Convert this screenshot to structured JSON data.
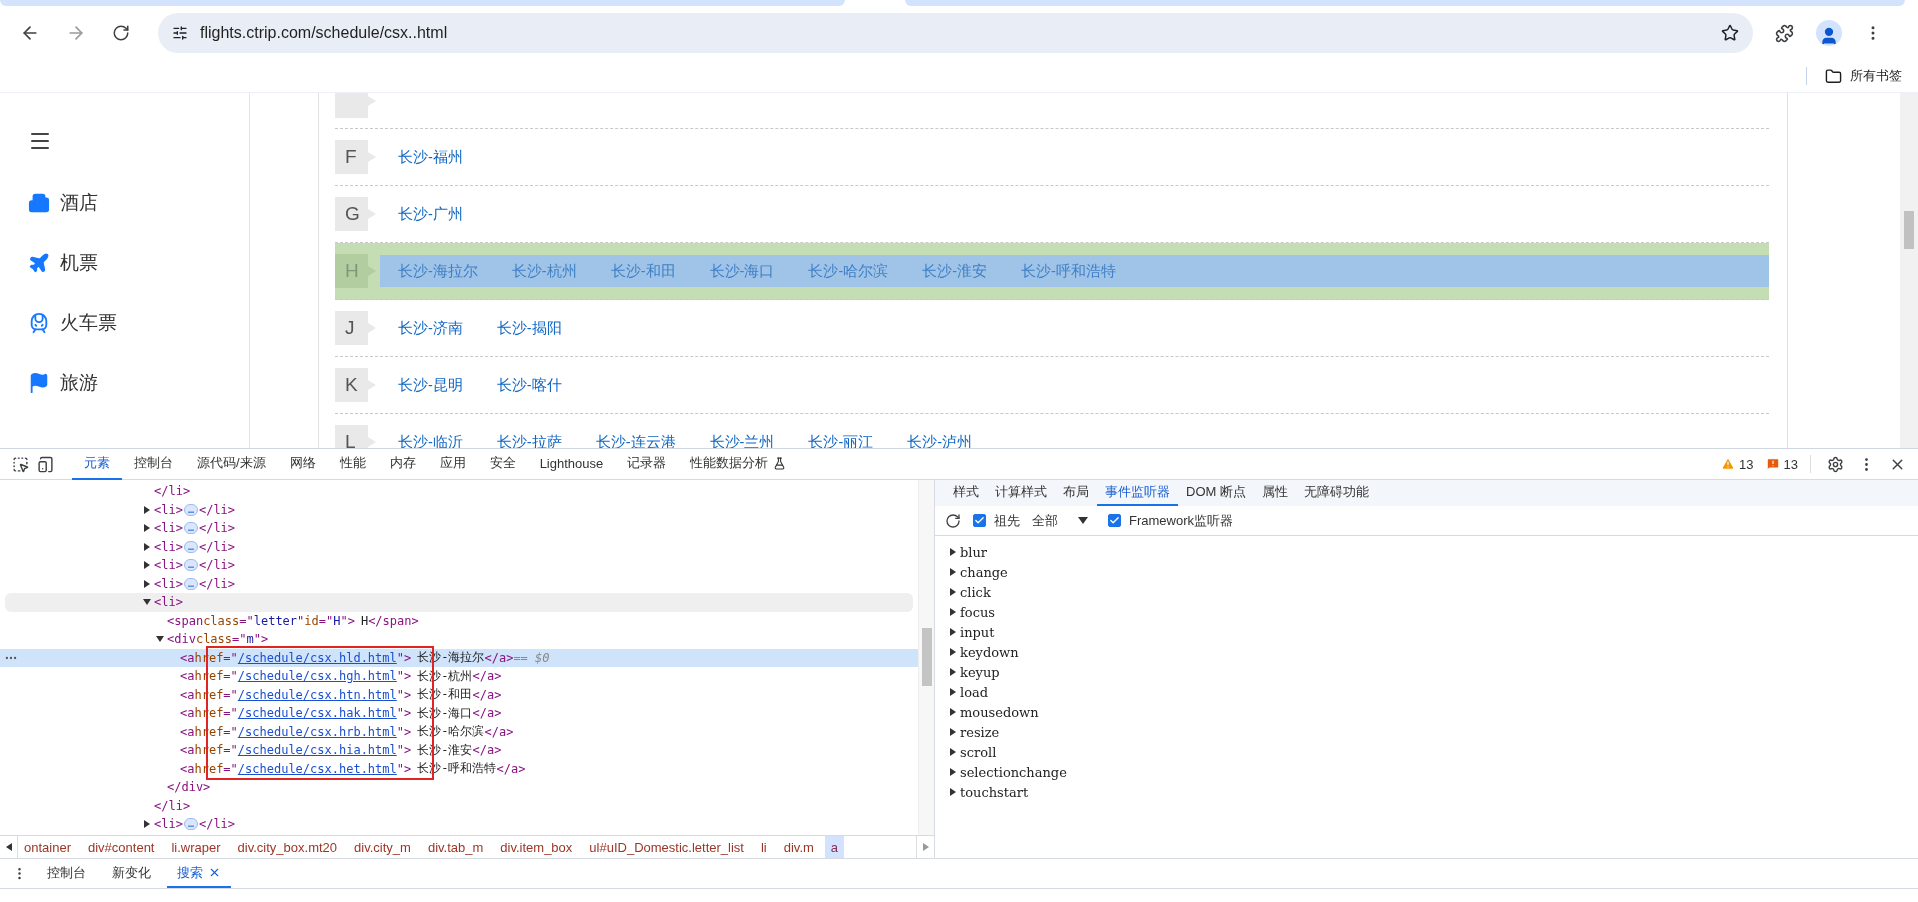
{
  "browser": {
    "url": "flights.ctrip.com/schedule/csx..html",
    "bookmarks_folder": "所有书签"
  },
  "page": {
    "sidebar": [
      {
        "kind": "hotel",
        "label": "酒店"
      },
      {
        "kind": "flight",
        "label": "机票"
      },
      {
        "kind": "train",
        "label": "火车票"
      },
      {
        "kind": "travel",
        "label": "旅游"
      }
    ],
    "letter_rows": [
      {
        "letter": "F",
        "highlighted": false,
        "links": [
          "长沙-福州"
        ]
      },
      {
        "letter": "G",
        "highlighted": false,
        "links": [
          "长沙-广州"
        ]
      },
      {
        "letter": "H",
        "highlighted": true,
        "links": [
          "长沙-海拉尔",
          "长沙-杭州",
          "长沙-和田",
          "长沙-海口",
          "长沙-哈尔滨",
          "长沙-淮安",
          "长沙-呼和浩特"
        ]
      },
      {
        "letter": "J",
        "highlighted": false,
        "links": [
          "长沙-济南",
          "长沙-揭阳"
        ]
      },
      {
        "letter": "K",
        "highlighted": false,
        "links": [
          "长沙-昆明",
          "长沙-喀什"
        ]
      },
      {
        "letter": "L",
        "highlighted": false,
        "links": [
          "长沙-临沂",
          "长沙-拉萨",
          "长沙-连云港",
          "长沙-兰州",
          "长沙-丽江",
          "长沙-泸州"
        ]
      }
    ]
  },
  "devtools": {
    "tabs": [
      {
        "label": "元素",
        "selected": true
      },
      {
        "label": "控制台",
        "selected": false
      },
      {
        "label": "源代码/来源",
        "selected": false
      },
      {
        "label": "网络",
        "selected": false
      },
      {
        "label": "性能",
        "selected": false
      },
      {
        "label": "内存",
        "selected": false
      },
      {
        "label": "应用",
        "selected": false
      },
      {
        "label": "安全",
        "selected": false
      },
      {
        "label": "Lighthouse",
        "selected": false
      },
      {
        "label": "记录器",
        "selected": false
      },
      {
        "label": "性能数据分析",
        "selected": false
      }
    ],
    "warnings": "13",
    "issues": "13",
    "dom_tree": [
      {
        "selected": false,
        "hovered": false,
        "tokens": [
          {
            "kind": "tag",
            "text": "</li>"
          }
        ]
      },
      {
        "selected": false,
        "hovered": false,
        "expanded": false,
        "tokens": [
          {
            "kind": "tag",
            "text": "<li>"
          },
          {
            "kind": "ellipsis",
            "text": "…"
          },
          {
            "kind": "tag",
            "text": "</li>"
          }
        ]
      },
      {
        "selected": false,
        "hovered": false,
        "expanded": false,
        "tokens": [
          {
            "kind": "tag",
            "text": "<li>"
          },
          {
            "kind": "ellipsis",
            "text": "…"
          },
          {
            "kind": "tag",
            "text": "</li>"
          }
        ]
      },
      {
        "selected": false,
        "hovered": false,
        "expanded": false,
        "tokens": [
          {
            "kind": "tag",
            "text": "<li>"
          },
          {
            "kind": "ellipsis",
            "text": "…"
          },
          {
            "kind": "tag",
            "text": "</li>"
          }
        ]
      },
      {
        "selected": false,
        "hovered": false,
        "expanded": false,
        "tokens": [
          {
            "kind": "tag",
            "text": "<li>"
          },
          {
            "kind": "ellipsis",
            "text": "…"
          },
          {
            "kind": "tag",
            "text": "</li>"
          }
        ]
      },
      {
        "selected": false,
        "hovered": false,
        "expanded": false,
        "tokens": [
          {
            "kind": "tag",
            "text": "<li>"
          },
          {
            "kind": "ellipsis",
            "text": "…"
          },
          {
            "kind": "tag",
            "text": "</li>"
          }
        ]
      },
      {
        "selected": false,
        "hovered": true,
        "expanded": true,
        "tokens": [
          {
            "kind": "tag",
            "text": "<li>"
          }
        ],
        "children": [
          {
            "selected": false,
            "hovered": false,
            "tokens": [
              {
                "kind": "tag",
                "text": "<span"
              },
              {
                "kind": "attr",
                "text": " class"
              },
              {
                "kind": "punct",
                "text": "=\""
              },
              {
                "kind": "value",
                "text": "letter"
              },
              {
                "kind": "punct",
                "text": "\""
              },
              {
                "kind": "attr",
                "text": " id"
              },
              {
                "kind": "punct",
                "text": "=\""
              },
              {
                "kind": "value",
                "text": "H"
              },
              {
                "kind": "punct",
                "text": "\""
              },
              {
                "kind": "tag",
                "text": ">"
              },
              {
                "kind": "text",
                "text": "H"
              },
              {
                "kind": "tag",
                "text": "</span>"
              }
            ]
          },
          {
            "selected": false,
            "hovered": false,
            "expanded": true,
            "tokens": [
              {
                "kind": "tag",
                "text": "<div"
              },
              {
                "kind": "attr",
                "text": " class"
              },
              {
                "kind": "punct",
                "text": "=\""
              },
              {
                "kind": "value",
                "text": "m"
              },
              {
                "kind": "punct",
                "text": "\""
              },
              {
                "kind": "tag",
                "text": ">"
              }
            ],
            "children": [
              {
                "selected": true,
                "hovered": false,
                "tokens": [
                  {
                    "kind": "tag",
                    "text": "<a"
                  },
                  {
                    "kind": "attr",
                    "text": " href"
                  },
                  {
                    "kind": "punct",
                    "text": "=\""
                  },
                  {
                    "kind": "link",
                    "text": "/schedule/csx.hld.html"
                  },
                  {
                    "kind": "punct",
                    "text": "\""
                  },
                  {
                    "kind": "tag",
                    "text": ">"
                  },
                  {
                    "kind": "text",
                    "text": "长沙-海拉尔"
                  },
                  {
                    "kind": "tag",
                    "text": "</a>"
                  },
                  {
                    "kind": "marker",
                    "text": " == $0"
                  }
                ]
              },
              {
                "selected": false,
                "hovered": false,
                "tokens": [
                  {
                    "kind": "tag",
                    "text": "<a"
                  },
                  {
                    "kind": "attr",
                    "text": " href"
                  },
                  {
                    "kind": "punct",
                    "text": "=\""
                  },
                  {
                    "kind": "link",
                    "text": "/schedule/csx.hgh.html"
                  },
                  {
                    "kind": "punct",
                    "text": "\""
                  },
                  {
                    "kind": "tag",
                    "text": ">"
                  },
                  {
                    "kind": "text",
                    "text": "长沙-杭州"
                  },
                  {
                    "kind": "tag",
                    "text": "</a>"
                  }
                ]
              },
              {
                "selected": false,
                "hovered": false,
                "tokens": [
                  {
                    "kind": "tag",
                    "text": "<a"
                  },
                  {
                    "kind": "attr",
                    "text": " href"
                  },
                  {
                    "kind": "punct",
                    "text": "=\""
                  },
                  {
                    "kind": "link",
                    "text": "/schedule/csx.htn.html"
                  },
                  {
                    "kind": "punct",
                    "text": "\""
                  },
                  {
                    "kind": "tag",
                    "text": ">"
                  },
                  {
                    "kind": "text",
                    "text": "长沙-和田"
                  },
                  {
                    "kind": "tag",
                    "text": "</a>"
                  }
                ]
              },
              {
                "selected": false,
                "hovered": false,
                "tokens": [
                  {
                    "kind": "tag",
                    "text": "<a"
                  },
                  {
                    "kind": "attr",
                    "text": " href"
                  },
                  {
                    "kind": "punct",
                    "text": "=\""
                  },
                  {
                    "kind": "link",
                    "text": "/schedule/csx.hak.html"
                  },
                  {
                    "kind": "punct",
                    "text": "\""
                  },
                  {
                    "kind": "tag",
                    "text": ">"
                  },
                  {
                    "kind": "text",
                    "text": "长沙-海口"
                  },
                  {
                    "kind": "tag",
                    "text": "</a>"
                  }
                ]
              },
              {
                "selected": false,
                "hovered": false,
                "tokens": [
                  {
                    "kind": "tag",
                    "text": "<a"
                  },
                  {
                    "kind": "attr",
                    "text": " href"
                  },
                  {
                    "kind": "punct",
                    "text": "=\""
                  },
                  {
                    "kind": "link",
                    "text": "/schedule/csx.hrb.html"
                  },
                  {
                    "kind": "punct",
                    "text": "\""
                  },
                  {
                    "kind": "tag",
                    "text": ">"
                  },
                  {
                    "kind": "text",
                    "text": "长沙-哈尔滨"
                  },
                  {
                    "kind": "tag",
                    "text": "</a>"
                  }
                ]
              },
              {
                "selected": false,
                "hovered": false,
                "tokens": [
                  {
                    "kind": "tag",
                    "text": "<a"
                  },
                  {
                    "kind": "attr",
                    "text": " href"
                  },
                  {
                    "kind": "punct",
                    "text": "=\""
                  },
                  {
                    "kind": "link",
                    "text": "/schedule/csx.hia.html"
                  },
                  {
                    "kind": "punct",
                    "text": "\""
                  },
                  {
                    "kind": "tag",
                    "text": ">"
                  },
                  {
                    "kind": "text",
                    "text": "长沙-淮安"
                  },
                  {
                    "kind": "tag",
                    "text": "</a>"
                  }
                ]
              },
              {
                "selected": false,
                "hovered": false,
                "tokens": [
                  {
                    "kind": "tag",
                    "text": "<a"
                  },
                  {
                    "kind": "attr",
                    "text": " href"
                  },
                  {
                    "kind": "punct",
                    "text": "=\""
                  },
                  {
                    "kind": "link",
                    "text": "/schedule/csx.het.html"
                  },
                  {
                    "kind": "punct",
                    "text": "\""
                  },
                  {
                    "kind": "tag",
                    "text": ">"
                  },
                  {
                    "kind": "text",
                    "text": "长沙-呼和浩特"
                  },
                  {
                    "kind": "tag",
                    "text": "</a>"
                  }
                ]
              }
            ],
            "closing": [
              {
                "kind": "tag",
                "text": "</div>"
              }
            ]
          }
        ],
        "closing": [
          {
            "kind": "tag",
            "text": "</li>"
          }
        ]
      },
      {
        "selected": false,
        "hovered": false,
        "expanded": false,
        "tokens": [
          {
            "kind": "tag",
            "text": "<li>"
          },
          {
            "kind": "ellipsis",
            "text": "…"
          },
          {
            "kind": "tag",
            "text": "</li>"
          }
        ]
      }
    ],
    "breadcrumbs": [
      {
        "label": "ontainer",
        "selected": false
      },
      {
        "label": "div#content",
        "selected": false
      },
      {
        "label": "li.wraper",
        "selected": false
      },
      {
        "label": "div.city_box.mt20",
        "selected": false
      },
      {
        "label": "div.city_m",
        "selected": false
      },
      {
        "label": "div.tab_m",
        "selected": false
      },
      {
        "label": "div.item_box",
        "selected": false
      },
      {
        "label": "ul#uID_Domestic.letter_list",
        "selected": false
      },
      {
        "label": "li",
        "selected": false
      },
      {
        "label": "div.m",
        "selected": false
      },
      {
        "label": "a",
        "selected": true
      }
    ],
    "side_tabs": [
      {
        "label": "样式",
        "selected": false
      },
      {
        "label": "计算样式",
        "selected": false
      },
      {
        "label": "布局",
        "selected": false
      },
      {
        "label": "事件监听器",
        "selected": true
      },
      {
        "label": "DOM 断点",
        "selected": false
      },
      {
        "label": "属性",
        "selected": false
      },
      {
        "label": "无障碍功能",
        "selected": false
      }
    ],
    "listener_filters": {
      "ancestors": {
        "label": "祖先",
        "checked": true
      },
      "scope": "全部",
      "framework": {
        "label": "Framework监听器",
        "checked": true
      }
    },
    "events": [
      "blur",
      "change",
      "click",
      "focus",
      "input",
      "keydown",
      "keyup",
      "load",
      "mousedown",
      "resize",
      "scroll",
      "selectionchange",
      "touchstart"
    ],
    "drawer_tabs": [
      {
        "label": "控制台",
        "selected": false,
        "closable": false
      },
      {
        "label": "新变化",
        "selected": false,
        "closable": false
      },
      {
        "label": "搜索",
        "selected": true,
        "closable": true
      }
    ]
  }
}
